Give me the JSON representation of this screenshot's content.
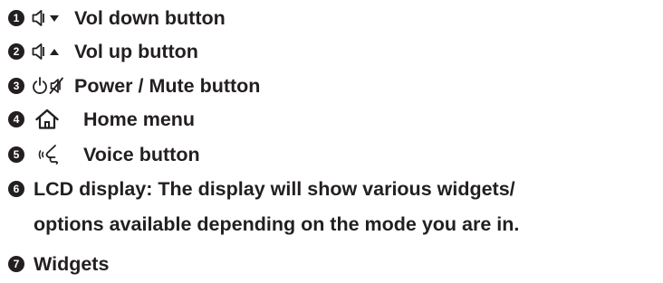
{
  "legend": {
    "items": [
      {
        "number": "1",
        "icon": "volume-down-icon",
        "label": "Vol down button"
      },
      {
        "number": "2",
        "icon": "volume-up-icon",
        "label": "Vol up button"
      },
      {
        "number": "3",
        "icon": "power-mute-icon",
        "label": "Power / Mute button"
      },
      {
        "number": "4",
        "icon": "home-icon",
        "label": "Home menu"
      },
      {
        "number": "5",
        "icon": "voice-icon",
        "label": "Voice button"
      },
      {
        "number": "6",
        "label": "LCD display: The display will show various widgets/",
        "continuation": "options available depending on the mode you are in."
      },
      {
        "number": "7",
        "label": "Widgets"
      }
    ]
  }
}
